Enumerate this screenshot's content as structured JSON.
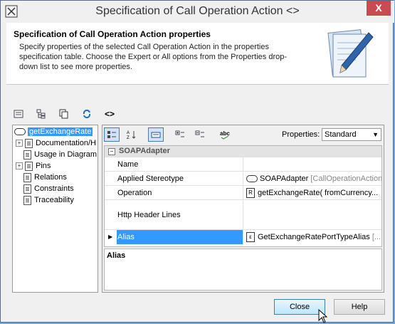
{
  "window": {
    "title": "Specification of Call Operation Action <>",
    "close_label": "X"
  },
  "header": {
    "title": "Specification of Call Operation Action properties",
    "description": "Specify properties of the selected Call Operation Action in the properties specification table. Choose the Expert or All options from the Properties drop-down list to see more properties."
  },
  "toolbar": {
    "symbol_label": "<>"
  },
  "tree": {
    "selected": "getExchangeRate",
    "items": [
      {
        "label": "Documentation/H",
        "expandable": true
      },
      {
        "label": "Usage in Diagram",
        "expandable": false
      },
      {
        "label": "Pins",
        "expandable": true
      },
      {
        "label": "Relations",
        "expandable": false
      },
      {
        "label": "Constraints",
        "expandable": false
      },
      {
        "label": "Traceability",
        "expandable": false
      }
    ]
  },
  "properties": {
    "label": "Properties:",
    "mode": "Standard",
    "group": "SOAPAdapter",
    "rows": [
      {
        "name": "Name",
        "value": "",
        "value_suffix": ""
      },
      {
        "name": "Applied Stereotype",
        "value": "SOAPAdapter",
        "value_suffix": "[CallOperationAction]"
      },
      {
        "name": "Operation",
        "value": "getExchangeRate( fromCurrency...",
        "value_suffix": ""
      },
      {
        "name": "Http Header Lines",
        "value": "",
        "value_suffix": ""
      },
      {
        "name": "Alias",
        "value": "GetExchangeRatePortTypeAlias",
        "value_suffix": "[..."
      }
    ]
  },
  "description_panel": {
    "title": "Alias"
  },
  "buttons": {
    "close": "Close",
    "help": "Help"
  },
  "colors": {
    "selection": "#3399ff",
    "close_button": "#c74b50"
  }
}
